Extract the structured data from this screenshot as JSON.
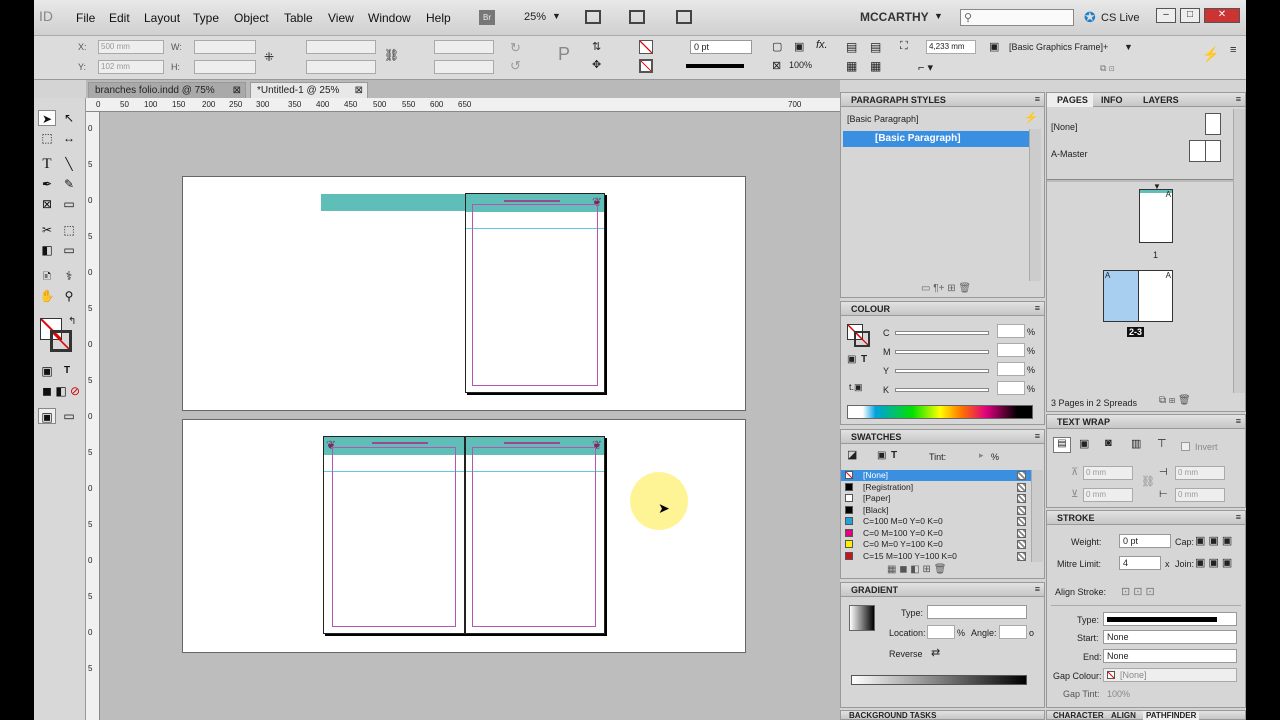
{
  "app": {
    "logo": "ID"
  },
  "menu": [
    "File",
    "Edit",
    "Layout",
    "Type",
    "Object",
    "Table",
    "View",
    "Window",
    "Help"
  ],
  "appbar": {
    "bridge": "Br",
    "zoom": "25%",
    "workspace": "MCCARTHY",
    "cs_live": "CS Live"
  },
  "control": {
    "x_label": "X:",
    "x_value": "500 mm",
    "y_label": "Y:",
    "y_value": "102 mm",
    "w_label": "W:",
    "h_label": "H:",
    "stroke_weight": "0 pt",
    "opacity": "100%",
    "fit_value": "4,233 mm",
    "object_style": "[Basic Graphics Frame]+"
  },
  "tabs": [
    {
      "label": "branches folio.indd @ 75%"
    },
    {
      "label": "*Untitled-1 @ 25%"
    }
  ],
  "ruler_h": [
    "0",
    "50",
    "100",
    "150",
    "200",
    "250",
    "300",
    "350",
    "400",
    "450",
    "500",
    "550",
    "600",
    "650",
    "700"
  ],
  "ruler_v": [
    "0",
    "5",
    "0",
    "5",
    "0",
    "5",
    "0",
    "5",
    "0",
    "5",
    "0",
    "5",
    "0",
    "5",
    "0",
    "5"
  ],
  "paragraph_styles": {
    "title": "PARAGRAPH STYLES",
    "current": "[Basic Paragraph]",
    "items": [
      "[Basic Paragraph]"
    ]
  },
  "colour": {
    "title": "COLOUR",
    "channels": [
      {
        "label": "C",
        "unit": "%"
      },
      {
        "label": "M",
        "unit": "%"
      },
      {
        "label": "Y",
        "unit": "%"
      },
      {
        "label": "K",
        "unit": "%"
      }
    ],
    "text_label": "T"
  },
  "swatches": {
    "title": "SWATCHES",
    "tint_label": "Tint:",
    "tint_unit": "%",
    "items": [
      {
        "name": "[None]",
        "color": "#ffffff"
      },
      {
        "name": "[Registration]",
        "color": "#000000"
      },
      {
        "name": "[Paper]",
        "color": "#ffffff"
      },
      {
        "name": "[Black]",
        "color": "#000000"
      },
      {
        "name": "C=100 M=0 Y=0 K=0",
        "color": "#1ea3dc"
      },
      {
        "name": "C=0 M=100 Y=0 K=0",
        "color": "#e3007e"
      },
      {
        "name": "C=0 M=0 Y=100 K=0",
        "color": "#fff000"
      },
      {
        "name": "C=15 M=100 Y=100 K=0",
        "color": "#c4161c"
      }
    ]
  },
  "gradient": {
    "title": "GRADIENT",
    "type_label": "Type:",
    "location_label": "Location:",
    "location_unit": "%",
    "angle_label": "Angle:",
    "angle_unit": "o",
    "reverse_label": "Reverse"
  },
  "bottom_tab": "BACKGROUND TASKS",
  "pages": {
    "tabs": [
      "PAGES",
      "INFO",
      "LAYERS"
    ],
    "masters": [
      "[None]",
      "A-Master"
    ],
    "page1_label": "1",
    "spread_label": "2-3",
    "master_letter": "A",
    "status": "3 Pages in 2 Spreads"
  },
  "text_wrap": {
    "title": "TEXT WRAP",
    "invert_label": "Invert",
    "values": [
      "0 mm",
      "0 mm",
      "0 mm",
      "0 mm"
    ]
  },
  "stroke": {
    "title": "STROKE",
    "weight_label": "Weight:",
    "weight_value": "0 pt",
    "cap_label": "Cap:",
    "mitre_label": "Mitre Limit:",
    "mitre_value": "4",
    "mitre_x": "x",
    "join_label": "Join:",
    "align_label": "Align Stroke:",
    "type_label": "Type:",
    "start_label": "Start:",
    "start_value": "None",
    "end_label": "End:",
    "end_value": "None",
    "gap_colour_label": "Gap Colour:",
    "gap_colour_value": "[None]",
    "gap_tint_label": "Gap Tint:",
    "gap_tint_value": "100%"
  },
  "bottom_tabs_right": [
    "CHARACTER",
    "ALIGN",
    "PATHFINDER"
  ],
  "accent": "#5fbfb8",
  "selection": "#3b8fe0"
}
